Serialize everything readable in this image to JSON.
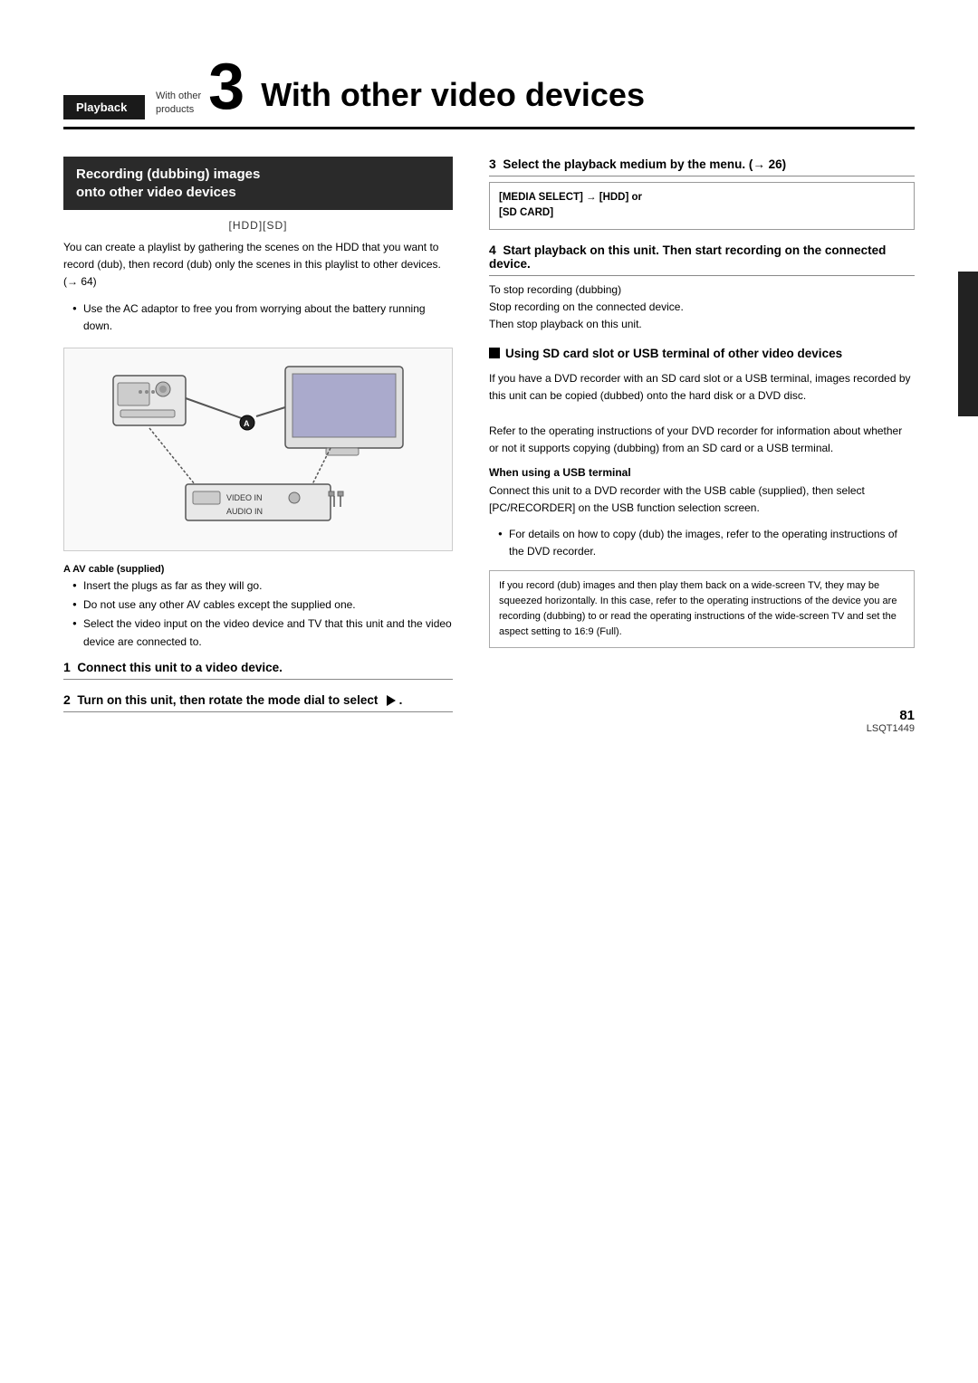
{
  "breadcrumb": {
    "section": "Playback",
    "subsection": "With other\nproducts"
  },
  "chapter": {
    "number": "3",
    "title": "With other video devices"
  },
  "left": {
    "section_title": "Recording (dubbing) images\nonto other video devices",
    "media_label": "[HDD][SD]",
    "body": "You can create a playlist by gathering the scenes on the HDD that you want to record (dub), then record (dub) only the scenes in this playlist to other devices. (→ 64)",
    "bullets": [
      "Use the AC adaptor to free you from worrying about the battery running down."
    ],
    "annotation_a": "A AV cable (supplied)",
    "annotation_bullets": [
      "Insert the plugs as far as they will go.",
      "Do not use any other AV cables except the supplied one.",
      "Select the video input on the video device and TV that this unit and the video device are connected to."
    ],
    "step1_label": "1",
    "step1_text": "Connect this unit to a video device.",
    "step2_label": "2",
    "step2_text": "Turn on this unit, then rotate the mode dial to select"
  },
  "right": {
    "step3_label": "3",
    "step3_text": "Select the playback medium by the menu. (→ 26)",
    "info_box": {
      "label": "[MEDIA SELECT]",
      "text": "→ [HDD] or\n[SD CARD]"
    },
    "step4_label": "4",
    "step4_text": "Start playback on this unit. Then start recording on the connected device.",
    "stop_recording_note": "To stop recording (dubbing)\nStop recording on the connected device.\nThen stop playback on this unit.",
    "section2_title": "Using SD card slot or USB terminal of other video devices",
    "section2_body": "If you have a DVD recorder with an SD card slot or a USB terminal, images recorded by this unit can be copied (dubbed) onto the hard disk or a DVD disc.\nRefer to the operating instructions of your DVD recorder for information about whether or not it supports copying (dubbing) from an SD card or a USB terminal.",
    "usb_heading": "When using a USB terminal",
    "usb_body": "Connect this unit to a DVD recorder with the USB cable (supplied), then select [PC/RECORDER] on the USB function selection screen.",
    "usb_bullet": "For details on how to copy (dub) the images, refer to the operating instructions of the DVD recorder.",
    "note_box": "If you record (dub) images and then play them back on a wide-screen TV, they may be squeezed horizontally. In this case, refer to the operating instructions of the device you are recording (dubbing) to or read the operating instructions of the wide-screen TV and set the aspect setting to 16:9 (Full)."
  },
  "footer": {
    "page_number": "81",
    "code": "LSQT1449"
  }
}
